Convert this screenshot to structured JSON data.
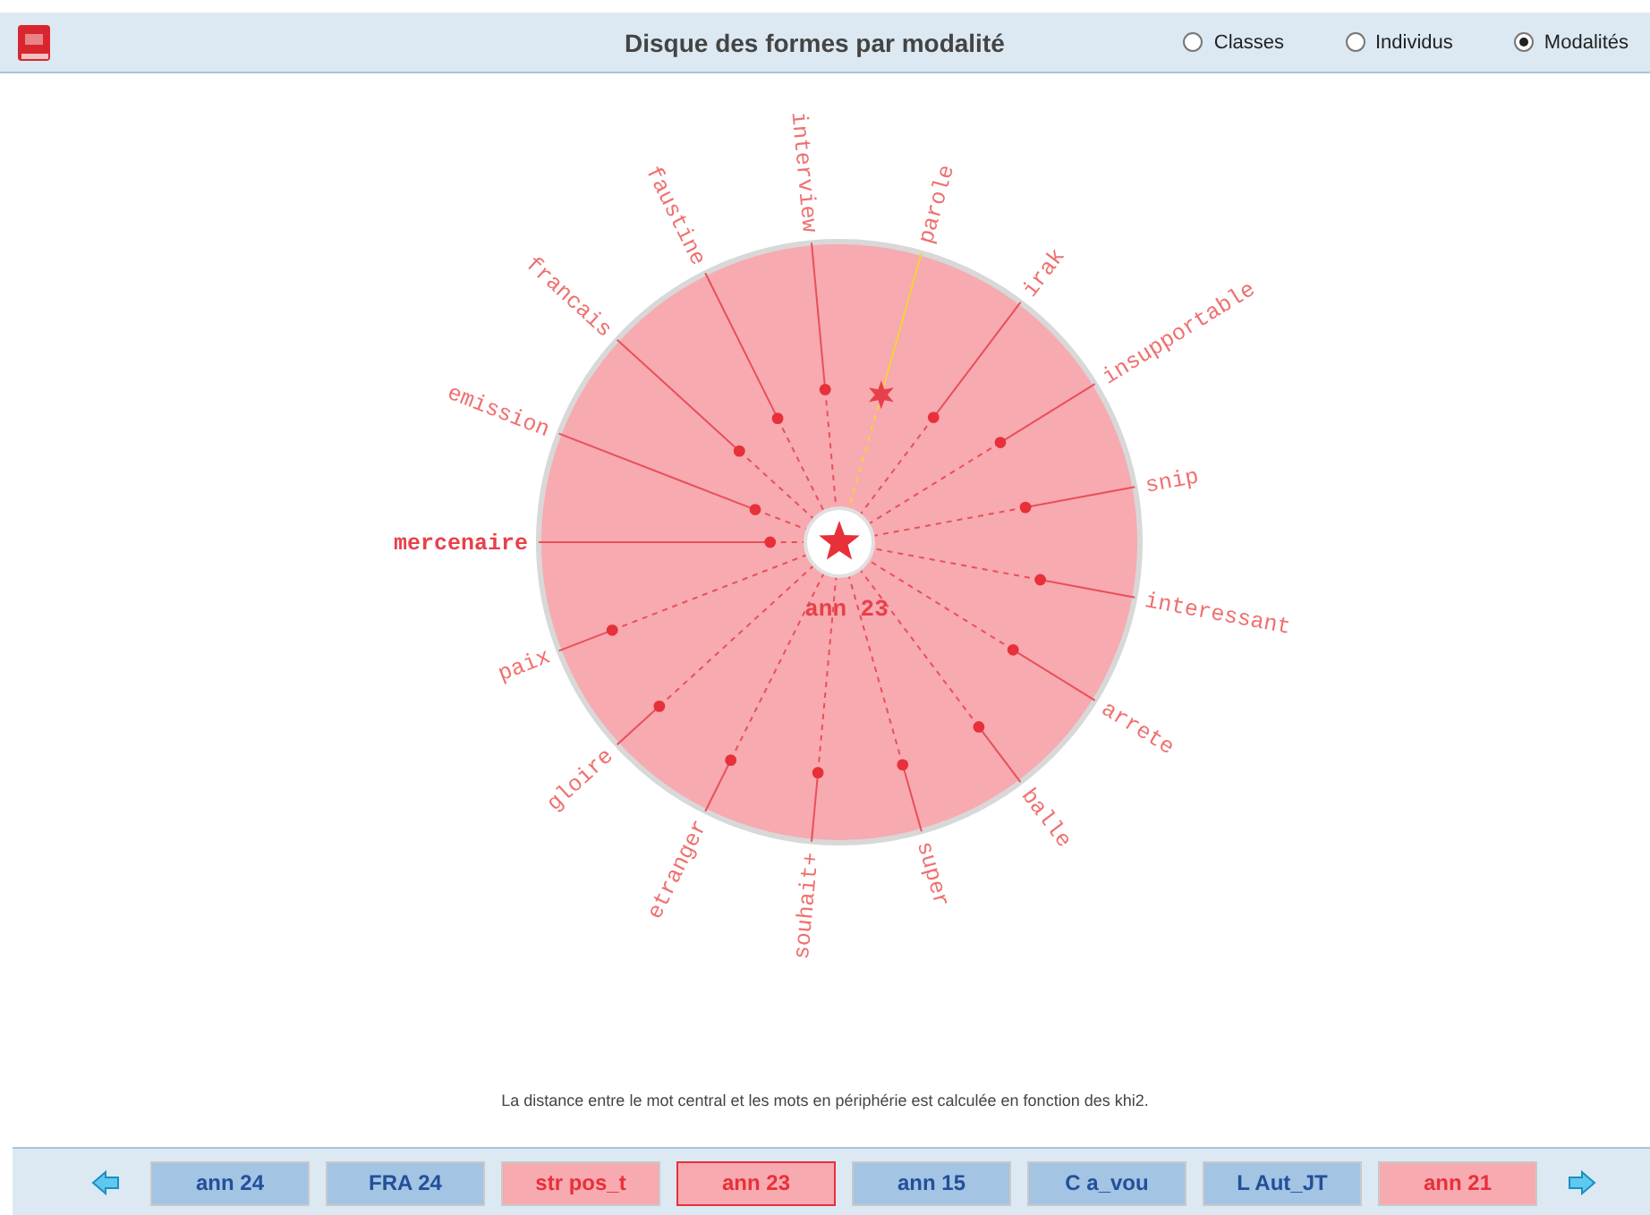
{
  "header": {
    "title": "Disque des formes par modalité",
    "radios": [
      {
        "label": "Classes",
        "selected": false
      },
      {
        "label": "Individus",
        "selected": false
      },
      {
        "label": "Modalités",
        "selected": true
      }
    ]
  },
  "disc": {
    "center_label": "ann 23",
    "words": [
      {
        "text": "mercenaire",
        "selected": false,
        "bold": true
      },
      {
        "text": "emission",
        "selected": false,
        "bold": false
      },
      {
        "text": "francais",
        "selected": false,
        "bold": false
      },
      {
        "text": "faustine",
        "selected": false,
        "bold": false
      },
      {
        "text": "interview",
        "selected": false,
        "bold": false
      },
      {
        "text": "parole",
        "selected": true,
        "bold": false
      },
      {
        "text": "irak",
        "selected": false,
        "bold": false
      },
      {
        "text": "insupportable",
        "selected": false,
        "bold": false
      },
      {
        "text": "snip",
        "selected": false,
        "bold": false
      },
      {
        "text": "interessant",
        "selected": false,
        "bold": false
      },
      {
        "text": "arrete",
        "selected": false,
        "bold": false
      },
      {
        "text": "balle",
        "selected": false,
        "bold": false
      },
      {
        "text": "super",
        "selected": false,
        "bold": false
      },
      {
        "text": "souhait+",
        "selected": false,
        "bold": false
      },
      {
        "text": "etranger",
        "selected": false,
        "bold": false
      },
      {
        "text": "gloire",
        "selected": false,
        "bold": false
      },
      {
        "text": "paix",
        "selected": false,
        "bold": false
      }
    ]
  },
  "caption": "La distance entre le mot central et les mots en périphérie est calculée en fonction des khi2.",
  "footer": {
    "buttons": [
      {
        "label": "ann 24",
        "color": "#a3c4e3",
        "selected": false
      },
      {
        "label": "FRA 24",
        "color": "#a3c4e3",
        "selected": false
      },
      {
        "label": "str pos_t",
        "color": "#f7aab0",
        "selected": false
      },
      {
        "label": "ann 23",
        "color": "#f7aab0",
        "selected": true
      },
      {
        "label": "ann 15",
        "color": "#a3c4e3",
        "selected": false
      },
      {
        "label": "C a_vou",
        "color": "#a3c4e3",
        "selected": false
      },
      {
        "label": "L Aut_JT",
        "color": "#a3c4e3",
        "selected": false
      },
      {
        "label": "ann 21",
        "color": "#f7aab0",
        "selected": false
      }
    ]
  }
}
